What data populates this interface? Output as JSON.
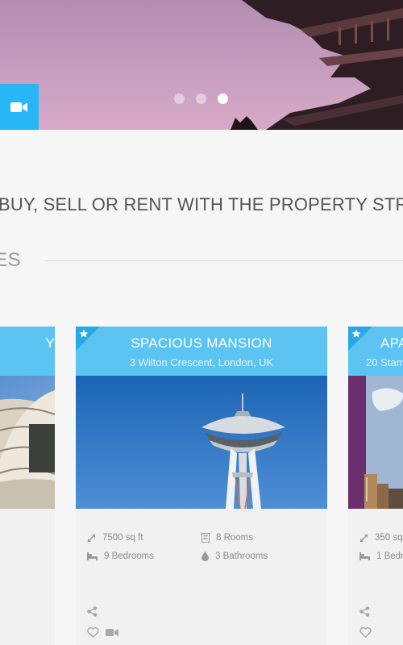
{
  "hero": {
    "slides": 3,
    "active_slide": 3
  },
  "tagline": "BUY, SELL OR RENT WITH THE PROPERTY STREET",
  "section_title": "IES",
  "cards": [
    {
      "title": "Y",
      "address": "",
      "featured": false
    },
    {
      "title": "SPACIOUS MANSION",
      "address": "3 Wilton Crescent, London, UK",
      "featured": true,
      "area": "7500 sq ft",
      "rooms": "8 Rooms",
      "bedrooms": "9 Bedrooms",
      "bathrooms": "3 Bathrooms"
    },
    {
      "title": "APA",
      "address": "20 Stam",
      "featured": true,
      "area": "350 sq",
      "bedrooms": "1 Bedr"
    }
  ],
  "colors": {
    "accent": "#29b6f6",
    "card_header": "#5bc4f3",
    "page_bg": "#f6f6f6"
  },
  "icons": {
    "hero_video": "video-camera-icon",
    "area": "resize-arrows-icon",
    "rooms": "building-icon",
    "bedrooms": "bed-icon",
    "bathrooms": "water-drop-icon",
    "share": "share-icon",
    "favorite": "heart-icon",
    "video": "video-camera-icon",
    "featured": "star-icon"
  }
}
